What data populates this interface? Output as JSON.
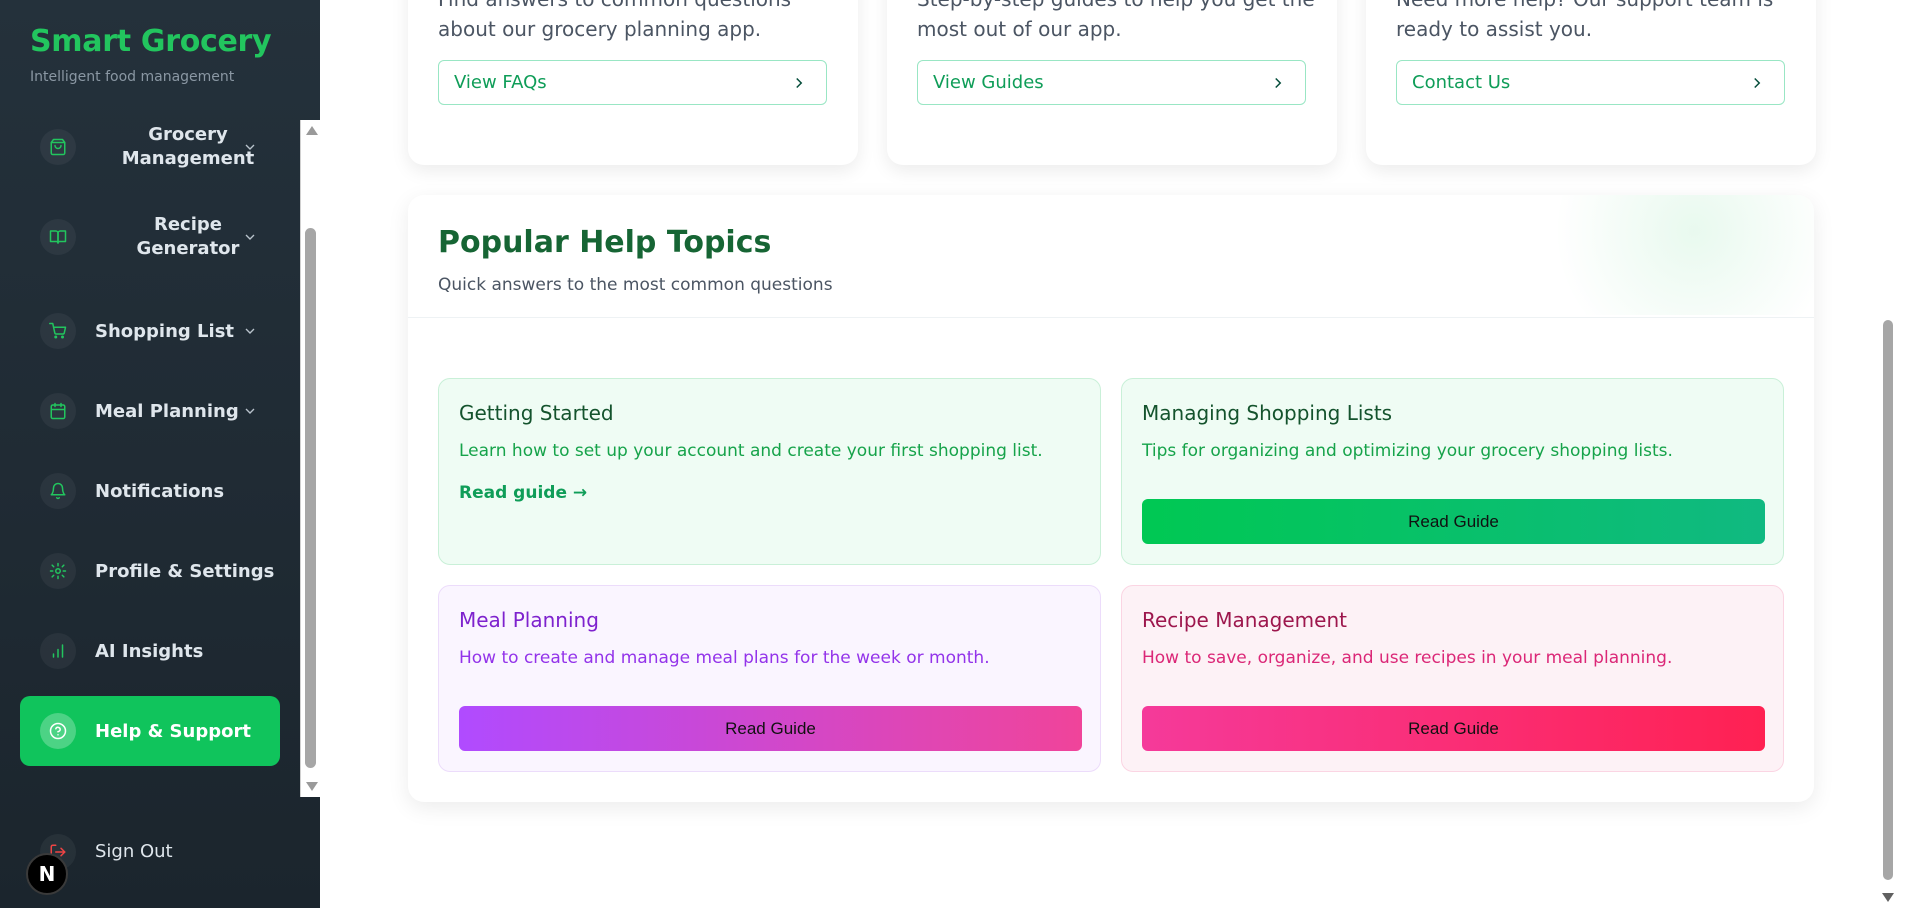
{
  "brand": {
    "title": "Smart Grocery",
    "subtitle": "Intelligent food management"
  },
  "sidebar": {
    "items": [
      {
        "label": "Grocery Management",
        "icon": "shopping-bag-icon",
        "expandable": true
      },
      {
        "label": "Recipe Generator",
        "icon": "book-icon",
        "expandable": true
      },
      {
        "label": "Shopping List",
        "icon": "cart-icon",
        "expandable": true
      },
      {
        "label": "Meal Planning",
        "icon": "calendar-icon",
        "expandable": true
      },
      {
        "label": "Notifications",
        "icon": "bell-icon",
        "expandable": false
      },
      {
        "label": "Profile & Settings",
        "icon": "gear-icon",
        "expandable": false
      },
      {
        "label": "AI Insights",
        "icon": "bar-chart-icon",
        "expandable": false
      },
      {
        "label": "Help & Support",
        "icon": "help-circle-icon",
        "expandable": false,
        "active": true
      }
    ],
    "signout": {
      "label": "Sign Out",
      "icon": "logout-icon"
    },
    "badge": "N"
  },
  "support_cards": [
    {
      "desc": "Find answers to common questions about our grocery planning app.",
      "button": "View FAQs"
    },
    {
      "desc": "Step-by-step guides to help you get the most out of our app.",
      "button": "View Guides"
    },
    {
      "desc": "Need more help? Our support team is ready to assist you.",
      "button": "Contact Us"
    }
  ],
  "topics": {
    "title": "Popular Help Topics",
    "subtitle": "Quick answers to the most common questions",
    "items": [
      {
        "title": "Getting Started",
        "desc": "Learn how to set up your account and create your first shopping list.",
        "link": "Read guide →"
      },
      {
        "title": "Managing Shopping Lists",
        "desc": "Tips for organizing and optimizing your grocery shopping lists.",
        "button": "Read Guide"
      },
      {
        "title": "Meal Planning",
        "desc": "How to create and manage meal plans for the week or month.",
        "button": "Read Guide"
      },
      {
        "title": "Recipe Management",
        "desc": "How to save, organize, and use recipes in your meal planning.",
        "button": "Read Guide"
      }
    ]
  },
  "colors": {
    "brand_green": "#22c55e",
    "active_nav": "#10c45c",
    "sidebar_bg": "#24313b"
  }
}
